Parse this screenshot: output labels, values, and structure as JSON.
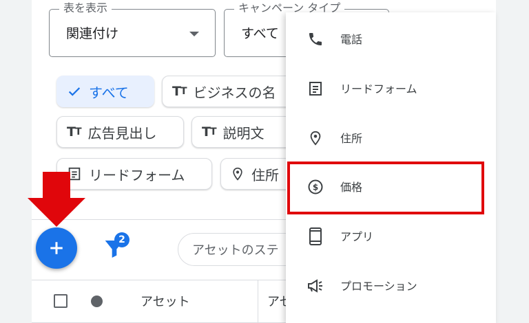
{
  "filters": {
    "view_select": {
      "label": "表を表示",
      "value": "関連付け"
    },
    "campaign_type_select": {
      "label": "キャンペーン タイプ",
      "value": "すべて"
    }
  },
  "chips": [
    {
      "label": "すべて",
      "icon": "check-icon",
      "selected": true
    },
    {
      "label": "ビジネスの名",
      "icon": "text-icon",
      "selected": false
    },
    {
      "label": "広告見出し",
      "icon": "text-icon",
      "selected": false
    },
    {
      "label": "説明文",
      "icon": "text-icon",
      "selected": false
    },
    {
      "label": "リードフォーム",
      "icon": "form-icon",
      "selected": false
    },
    {
      "label": "住所",
      "icon": "location-icon",
      "selected": false
    }
  ],
  "toolbar": {
    "filter_badge": "2",
    "status_search_placeholder": "アセットのステ"
  },
  "table": {
    "columns": [
      "アセット",
      "アセ"
    ]
  },
  "menu": {
    "items": [
      {
        "label": "電話",
        "icon": "phone-icon"
      },
      {
        "label": "リードフォーム",
        "icon": "form-icon"
      },
      {
        "label": "住所",
        "icon": "location-icon"
      },
      {
        "label": "価格",
        "icon": "price-icon",
        "highlighted": true
      },
      {
        "label": "アプリ",
        "icon": "smartphone-icon"
      },
      {
        "label": "プロモーション",
        "icon": "megaphone-icon"
      }
    ]
  },
  "colors": {
    "accent": "#1a73e8",
    "selected_chip_bg": "#e8f0fe",
    "annotation_red": "#e0060b"
  }
}
